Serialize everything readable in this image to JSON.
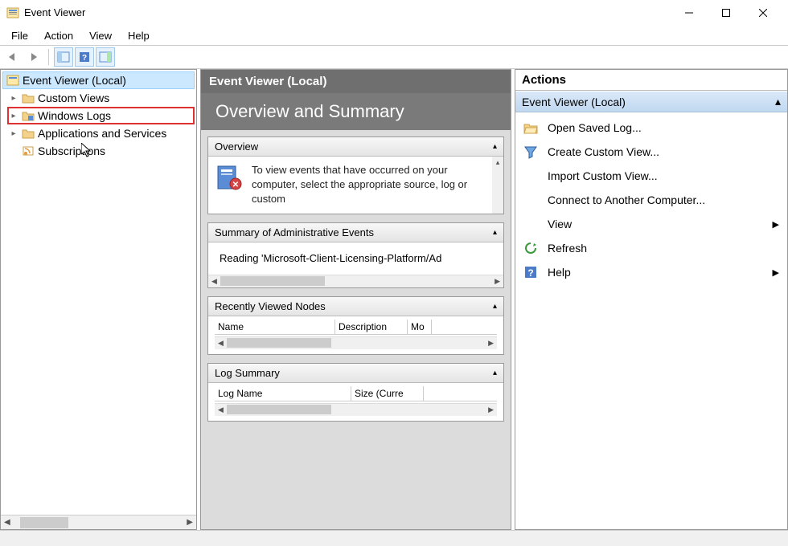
{
  "titlebar": {
    "title": "Event Viewer"
  },
  "menubar": {
    "items": [
      "File",
      "Action",
      "View",
      "Help"
    ]
  },
  "tree": {
    "root": "Event Viewer (Local)",
    "items": [
      {
        "label": "Custom Views",
        "expandable": true
      },
      {
        "label": "Windows Logs",
        "expandable": true,
        "highlight": true
      },
      {
        "label": "Applications and Services",
        "expandable": true
      },
      {
        "label": "Subscriptions",
        "expandable": false
      }
    ]
  },
  "center": {
    "header": "Event Viewer (Local)",
    "title": "Overview and Summary",
    "overview": {
      "head": "Overview",
      "text": "To view events that have occurred on your computer, select the appropriate source, log or custom"
    },
    "summary": {
      "head": "Summary of Administrative Events",
      "status": "Reading 'Microsoft-Client-Licensing-Platform/Ad"
    },
    "recent": {
      "head": "Recently Viewed Nodes",
      "cols": [
        "Name",
        "Description",
        "Mo"
      ]
    },
    "logsummary": {
      "head": "Log Summary",
      "cols": [
        "Log Name",
        "Size (Curre"
      ]
    }
  },
  "actions": {
    "header": "Actions",
    "subheader": "Event Viewer (Local)",
    "items": [
      {
        "label": "Open Saved Log...",
        "icon": "folder-open"
      },
      {
        "label": "Create Custom View...",
        "icon": "funnel"
      },
      {
        "label": "Import Custom View...",
        "icon": "blank"
      },
      {
        "label": "Connect to Another Computer...",
        "icon": "blank"
      },
      {
        "label": "View",
        "icon": "blank",
        "submenu": true
      },
      {
        "label": "Refresh",
        "icon": "refresh"
      },
      {
        "label": "Help",
        "icon": "help",
        "submenu": true
      }
    ]
  }
}
